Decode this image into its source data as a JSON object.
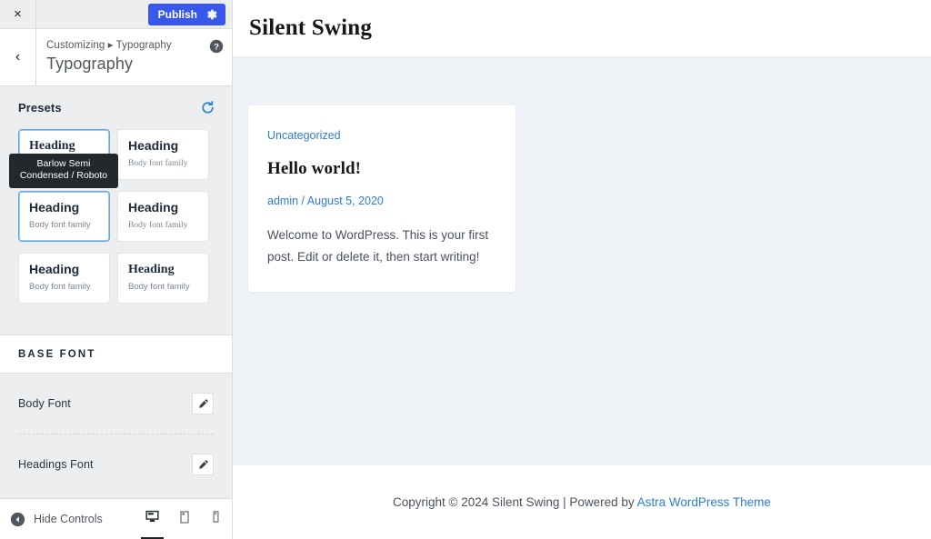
{
  "customizer": {
    "close_label": "×",
    "publish_label": "Publish",
    "gear_icon": "gear-icon",
    "close_icon": "close-icon",
    "back_icon": "chevron-left-icon",
    "breadcrumb": "Customizing ▸ Typography",
    "panel_title": "Typography",
    "help_icon": "help-circle-icon",
    "presets": {
      "label": "Presets",
      "reset_icon": "reset-icon",
      "tooltip": "Barlow Semi Condensed / Roboto",
      "items": [
        {
          "heading": "Heading",
          "body": "Body font family",
          "selected": true
        },
        {
          "heading": "Heading",
          "body": "Body font family",
          "selected": false
        },
        {
          "heading": "Heading",
          "body": "Body font family",
          "selected": true
        },
        {
          "heading": "Heading",
          "body": "Body font family",
          "selected": false
        },
        {
          "heading": "Heading",
          "body": "Body font family",
          "selected": false
        },
        {
          "heading": "Heading",
          "body": "Body font family",
          "selected": false
        }
      ]
    },
    "base_font": {
      "section_title": "BASE FONT",
      "rows": [
        {
          "label": "Body Font",
          "edit_icon": "pencil-icon"
        },
        {
          "label": "Headings Font",
          "edit_icon": "pencil-icon"
        }
      ]
    },
    "footer": {
      "hide_controls_label": "Hide Controls",
      "collapse_icon": "collapse-left-icon",
      "devices": [
        {
          "name": "desktop",
          "icon": "desktop-icon",
          "active": true
        },
        {
          "name": "tablet",
          "icon": "tablet-icon",
          "active": false
        },
        {
          "name": "mobile",
          "icon": "mobile-icon",
          "active": false
        }
      ]
    }
  },
  "preview": {
    "site_title": "Silent Swing",
    "post": {
      "category": "Uncategorized",
      "title": "Hello world!",
      "author": "admin",
      "meta_separator": " / ",
      "date": "August 5, 2020",
      "excerpt": "Welcome to WordPress. This is your first post. Edit or delete it, then start writing!"
    },
    "footer": {
      "copyright": "Copyright © 2024 Silent Swing | Powered by ",
      "theme_link": "Astra WordPress Theme"
    }
  },
  "colors": {
    "accent": "#3858e9",
    "link": "#2c7dd6",
    "preview_bg": "#eef2f6",
    "sidebar_bg": "#eceeef"
  }
}
